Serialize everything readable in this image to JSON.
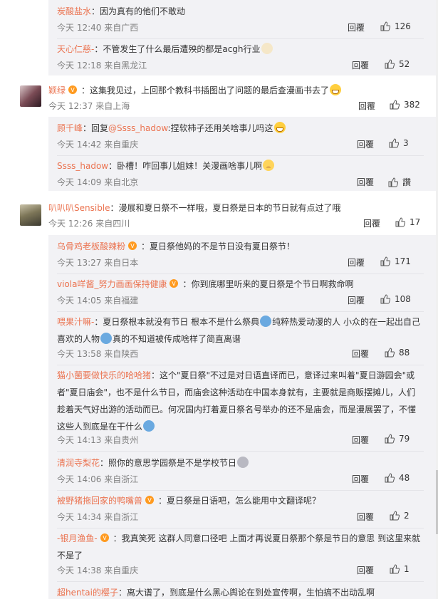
{
  "reply_label": "回覆",
  "sub1": [
    {
      "user": "炭酸盐水",
      "text": "：因为真有的他们不敢动",
      "time": "今天 12:40 来自广西",
      "likes": "126"
    },
    {
      "user": "天心仁慈-",
      "text": "：不管发生了什么最后遭殃的都是acgh行业",
      "time": "今天 12:18 来自黑龙江",
      "likes": "52"
    }
  ],
  "top1": {
    "user": "颖绿",
    "text": "：这集我见过，上回那个教科书插图出了问题的最后查漫画书去了",
    "time": "今天 12:37 来自上海",
    "likes": "382"
  },
  "sub2": [
    {
      "user": "顾千峰",
      "text": "：回复",
      "mention": "@Ssss_hadow",
      "text2": ":捏软柿子还用关啥事儿吗这",
      "time": "今天 14:42 来自重庆",
      "likes": "3"
    },
    {
      "user": "Ssss_hadow",
      "text": "：卧槽！咋回事儿姐妹！关漫画啥事儿啊",
      "time": "今天 14:09 来自北京",
      "likes": "讚"
    }
  ],
  "top2": {
    "user": "叭叭叭Sensible",
    "text": "：漫展和夏日祭不一样哦，夏日祭是日本的节日就有点过了哦",
    "time": "今天 12:26 来自四川",
    "likes": "17"
  },
  "sub3": [
    {
      "user": "乌骨鸡老板酸辣粉",
      "text": "：夏日祭他妈的不是节日没有夏日祭节！",
      "time": "今天 13:27 来自日本",
      "likes": "171"
    },
    {
      "user": "viola咩酱_努力画画保持健康",
      "text": "：你到底哪里听来的夏日祭是个节日啊救命啊",
      "time": "今天 14:05 来自福建",
      "likes": "108"
    },
    {
      "user": "喂果汁嘛-",
      "text": "：夏日祭根本就没有节日 根本不是什么祭典",
      "text2": "纯粹热爱动漫的人 小众的在一起出自己喜欢的人物",
      "text3": "真的不知道被传成啥样了简直离谱",
      "time": "今天 13:58 来自陕西",
      "likes": "88"
    },
    {
      "user": "猫小菌要做快乐的哈哈猪",
      "text": "：这个\"夏日祭\"不过是对日语直译而已，意译过来叫着\"夏日游园会\"或者\"夏日庙会\"，也不是什么节日，而庙会这种活动在中国本身就有，主要就是商贩摆摊儿，人们趁着天气好出游的活动而已。何况国内打着夏日祭名号举办的还不是庙会，而是漫展罢了，不懂这些人到底是在干什么",
      "time": "今天 14:13 来自贵州",
      "likes": "79"
    },
    {
      "user": "清润寺梨花",
      "text": "：照你的意思学园祭是不是学校节日",
      "time": "今天 14:06 来自浙江",
      "likes": "48"
    },
    {
      "user": "被野猪拖回家的鸭嘴兽",
      "text": "：夏日祭是日语吧，怎么能用中文翻译呢？",
      "time": "今天 14:34 来自浙江",
      "likes": "2"
    },
    {
      "user": "-银月渔鱼-",
      "text": "：我真笑死 这群人同意口径吧 上面才再说夏日祭那个祭是节日的意思 到这里来就不是了",
      "time": "今天 14:38 来自重庆",
      "likes": "1"
    },
    {
      "user": "超hentai的樱子",
      "text": "：离大谱了，到底是什么黑心舆论在到处宣传啊，生怕搞不出动乱啊",
      "time": "",
      "likes": ""
    }
  ]
}
